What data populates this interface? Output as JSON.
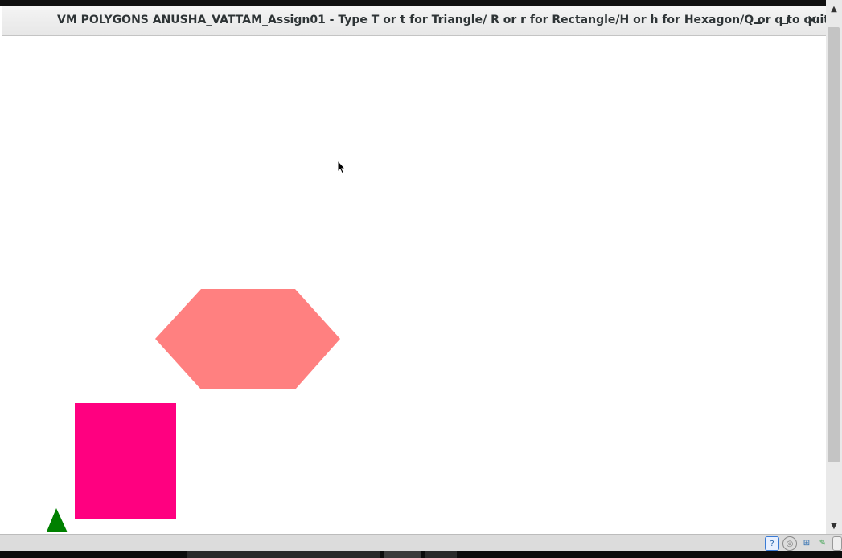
{
  "window": {
    "title": "VM POLYGONS ANUSHA_VATTAM_Assign01 - Type T or t for Triangle/ R or r for Rectangle/H or h for Hexagon/Q or q to quit",
    "buttons": {
      "minimize": "minimize",
      "maximize": "maximize",
      "close": "close"
    }
  },
  "canvas": {
    "shapes": [
      {
        "kind": "hexagon",
        "color": "#ff8080"
      },
      {
        "kind": "rectangle",
        "color": "#ff0080"
      },
      {
        "kind": "triangle",
        "color": "#008000"
      }
    ]
  },
  "status_icons": [
    "help-icon",
    "cd-icon",
    "network-icon",
    "pen-icon",
    "drive-icon"
  ]
}
